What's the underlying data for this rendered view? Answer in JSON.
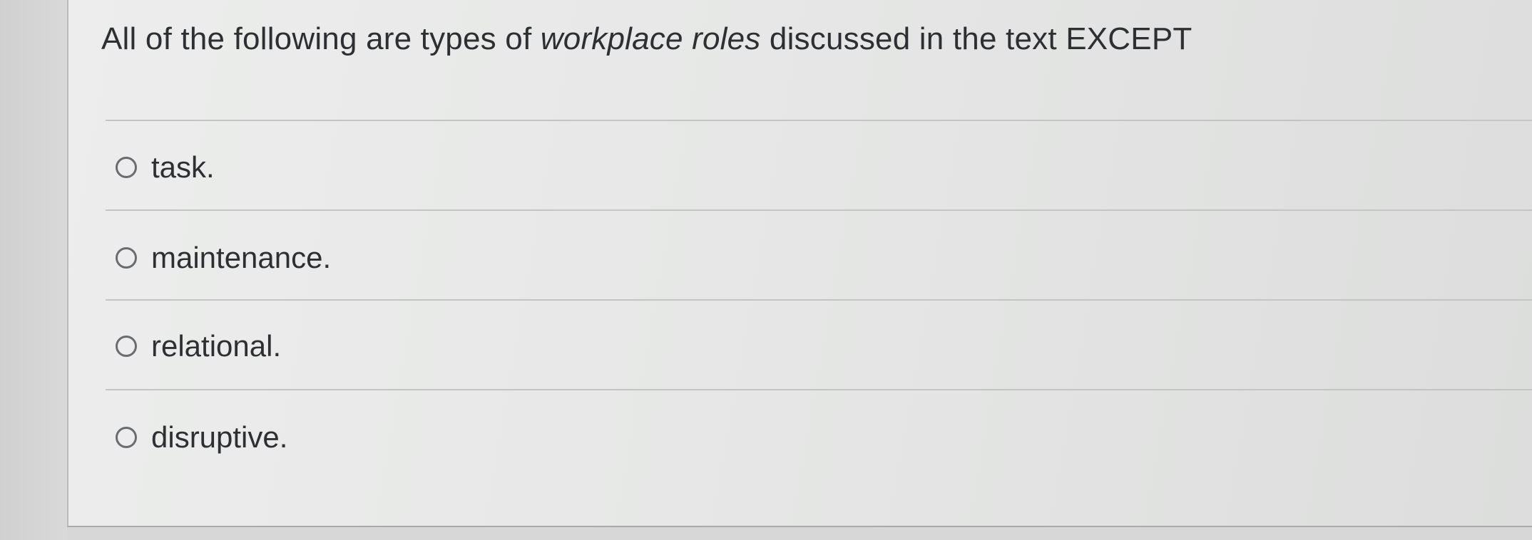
{
  "question": {
    "prefix": "All of the following are types of ",
    "emphasis": "workplace roles",
    "suffix": " discussed in the text EXCEPT"
  },
  "options": [
    {
      "label": "task.",
      "selected": false
    },
    {
      "label": "maintenance.",
      "selected": false
    },
    {
      "label": "relational.",
      "selected": false
    },
    {
      "label": "disruptive.",
      "selected": false
    }
  ],
  "colors": {
    "text": "#2e2f33",
    "radio_border": "#6a6b6e",
    "divider": "#c3c4c3",
    "background": "#e6e7e6"
  }
}
